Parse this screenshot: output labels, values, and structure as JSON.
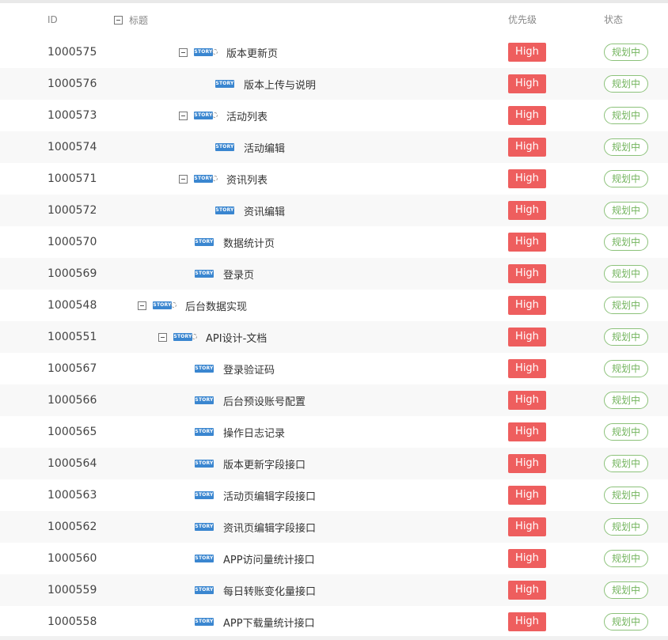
{
  "header": {
    "id_label": "ID",
    "title_label": "标题",
    "priority_label": "优先级",
    "status_label": "状态"
  },
  "rows": [
    {
      "id": "1000575",
      "title": "版本更新页",
      "priority": "High",
      "status": "规划中",
      "level": 2,
      "parent": true
    },
    {
      "id": "1000576",
      "title": "版本上传与说明",
      "priority": "High",
      "status": "规划中",
      "level": 3,
      "parent": false
    },
    {
      "id": "1000573",
      "title": "活动列表",
      "priority": "High",
      "status": "规划中",
      "level": 2,
      "parent": true
    },
    {
      "id": "1000574",
      "title": "活动编辑",
      "priority": "High",
      "status": "规划中",
      "level": 3,
      "parent": false
    },
    {
      "id": "1000571",
      "title": "资讯列表",
      "priority": "High",
      "status": "规划中",
      "level": 2,
      "parent": true
    },
    {
      "id": "1000572",
      "title": "资讯编辑",
      "priority": "High",
      "status": "规划中",
      "level": 3,
      "parent": false
    },
    {
      "id": "1000570",
      "title": "数据统计页",
      "priority": "High",
      "status": "规划中",
      "level": 2,
      "parent": false
    },
    {
      "id": "1000569",
      "title": "登录页",
      "priority": "High",
      "status": "规划中",
      "level": 2,
      "parent": false
    },
    {
      "id": "1000548",
      "title": "后台数据实现",
      "priority": "High",
      "status": "规划中",
      "level": 0,
      "parent": true
    },
    {
      "id": "1000551",
      "title": "API设计-文档",
      "priority": "High",
      "status": "规划中",
      "level": 1,
      "parent": true
    },
    {
      "id": "1000567",
      "title": "登录验证码",
      "priority": "High",
      "status": "规划中",
      "level": 2,
      "parent": false
    },
    {
      "id": "1000566",
      "title": "后台预设账号配置",
      "priority": "High",
      "status": "规划中",
      "level": 2,
      "parent": false
    },
    {
      "id": "1000565",
      "title": "操作日志记录",
      "priority": "High",
      "status": "规划中",
      "level": 2,
      "parent": false
    },
    {
      "id": "1000564",
      "title": "版本更新字段接口",
      "priority": "High",
      "status": "规划中",
      "level": 2,
      "parent": false
    },
    {
      "id": "1000563",
      "title": "活动页编辑字段接口",
      "priority": "High",
      "status": "规划中",
      "level": 2,
      "parent": false
    },
    {
      "id": "1000562",
      "title": "资讯页编辑字段接口",
      "priority": "High",
      "status": "规划中",
      "level": 2,
      "parent": false
    },
    {
      "id": "1000560",
      "title": "APP访问量统计接口",
      "priority": "High",
      "status": "规划中",
      "level": 2,
      "parent": false
    },
    {
      "id": "1000559",
      "title": "每日转账变化量接口",
      "priority": "High",
      "status": "规划中",
      "level": 2,
      "parent": false
    },
    {
      "id": "1000558",
      "title": "APP下载量统计接口",
      "priority": "High",
      "status": "规划中",
      "level": 2,
      "parent": false
    }
  ],
  "badge_text": "STORY",
  "colors": {
    "priority_high": "#ee5e5e",
    "status_planning": "#73b45d",
    "story_badge": "#3a86d0"
  }
}
